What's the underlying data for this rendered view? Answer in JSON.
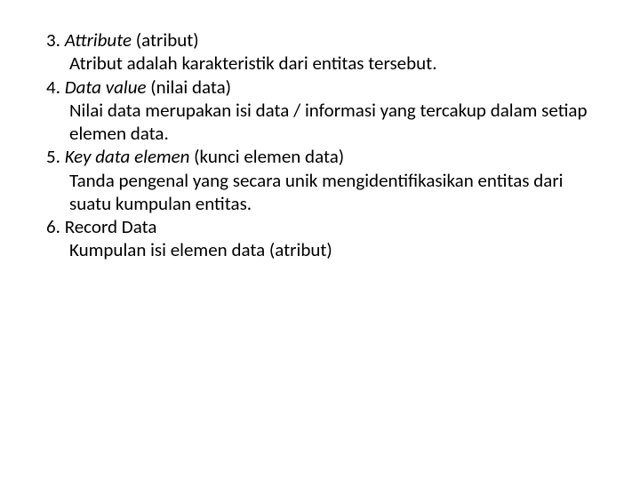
{
  "items": [
    {
      "num": "3. ",
      "title_italic": "Attribute",
      "title_plain": " (atribut)",
      "desc": "Atribut adalah karakteristik dari  entitas tersebut."
    },
    {
      "num": "4. ",
      "title_italic": "Data value",
      "title_plain": " (nilai data)",
      "desc": "Nilai data merupakan isi data / informasi yang tercakup dalam setiap elemen data."
    },
    {
      "num": "5. ",
      "title_italic": "Key data elemen",
      "title_plain": " (kunci elemen data)",
      "desc": "Tanda pengenal yang secara unik mengidentifikasikan entitas dari suatu kumpulan entitas."
    },
    {
      "num": "6. ",
      "title_italic": "",
      "title_plain": "Record Data",
      "desc": "Kumpulan isi elemen data (atribut)"
    }
  ]
}
